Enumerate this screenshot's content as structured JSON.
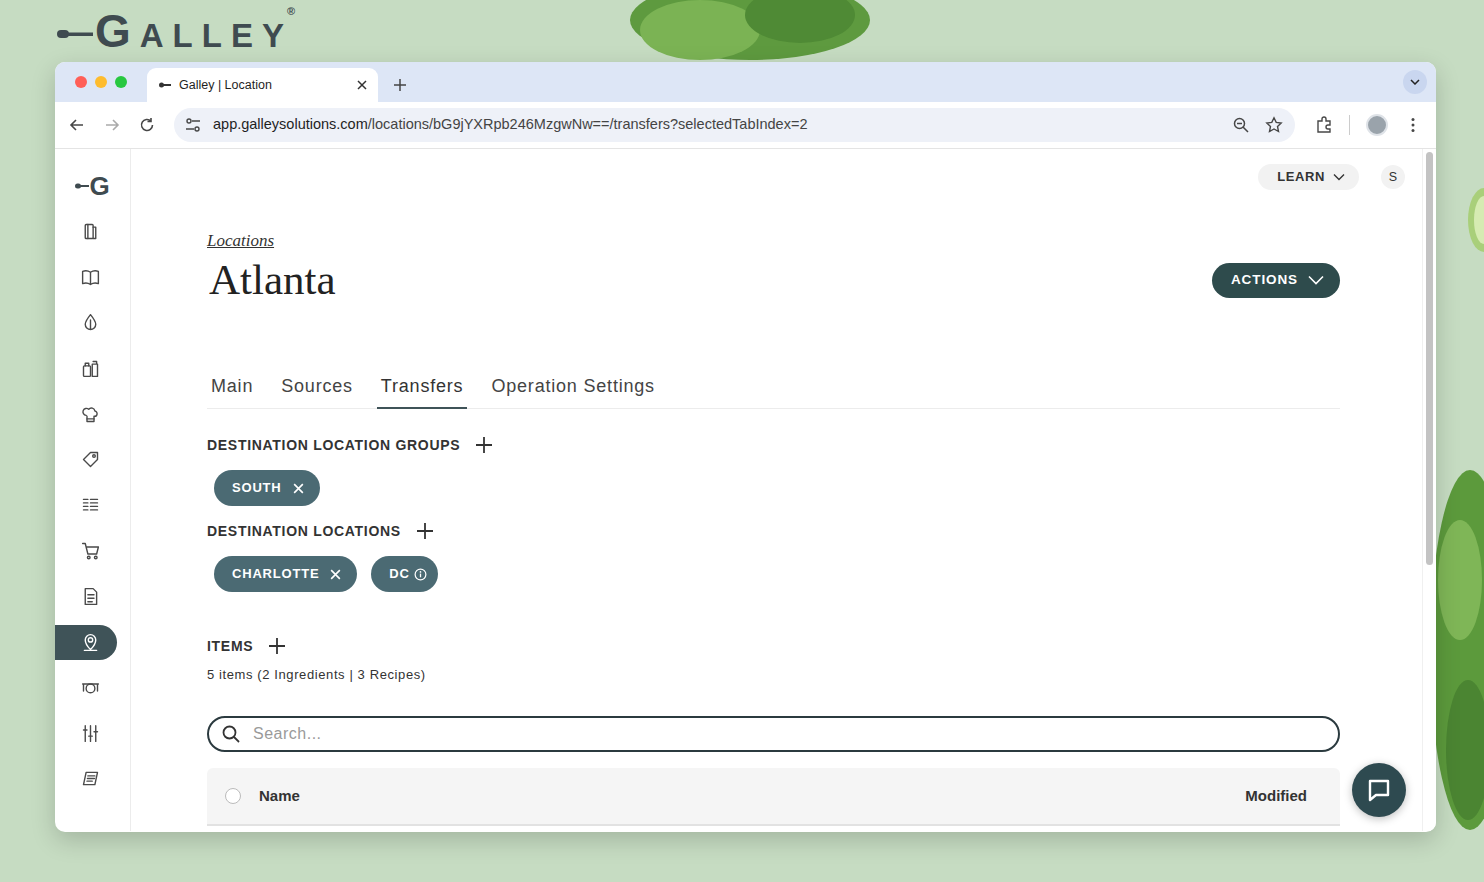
{
  "brand": {
    "name": "GALLEY",
    "registered": "®"
  },
  "browser": {
    "tab_title": "Galley | Location",
    "url_host": "app.galleysolutions.com",
    "url_path": "/locations/bG9jYXRpb246MzgwNw==/transfers?selectedTabIndex=2"
  },
  "sidebar": {
    "logo": "G",
    "items": [
      {
        "selected": false
      },
      {
        "selected": false
      },
      {
        "selected": false
      },
      {
        "selected": false
      },
      {
        "selected": false
      },
      {
        "selected": false
      },
      {
        "selected": false
      },
      {
        "selected": false
      },
      {
        "selected": false
      },
      {
        "selected": true
      },
      {
        "selected": false
      },
      {
        "selected": false
      },
      {
        "selected": false
      }
    ]
  },
  "header": {
    "learn": "LEARN",
    "avatar": "S"
  },
  "breadcrumb": "Locations",
  "title": "Atlanta",
  "actions": "ACTIONS",
  "tabs": [
    {
      "label": "Main",
      "selected": false
    },
    {
      "label": "Sources",
      "selected": false
    },
    {
      "label": "Transfers",
      "selected": true
    },
    {
      "label": "Operation Settings",
      "selected": false
    }
  ],
  "sections": [
    {
      "label": "DESTINATION LOCATION GROUPS",
      "chips": [
        {
          "label": "SOUTH",
          "kind": "removable"
        }
      ]
    },
    {
      "label": "DESTINATION LOCATIONS",
      "chips": [
        {
          "label": "CHARLOTTE",
          "kind": "removable"
        },
        {
          "label": "DC",
          "kind": "info"
        }
      ]
    }
  ],
  "items": {
    "label": "ITEMS",
    "count": "5 items (2 Ingredients | 3 Recipes)"
  },
  "search": {
    "placeholder": "Search..."
  },
  "table": {
    "columns": [
      "Name",
      "Modified"
    ],
    "all_selected": false
  }
}
